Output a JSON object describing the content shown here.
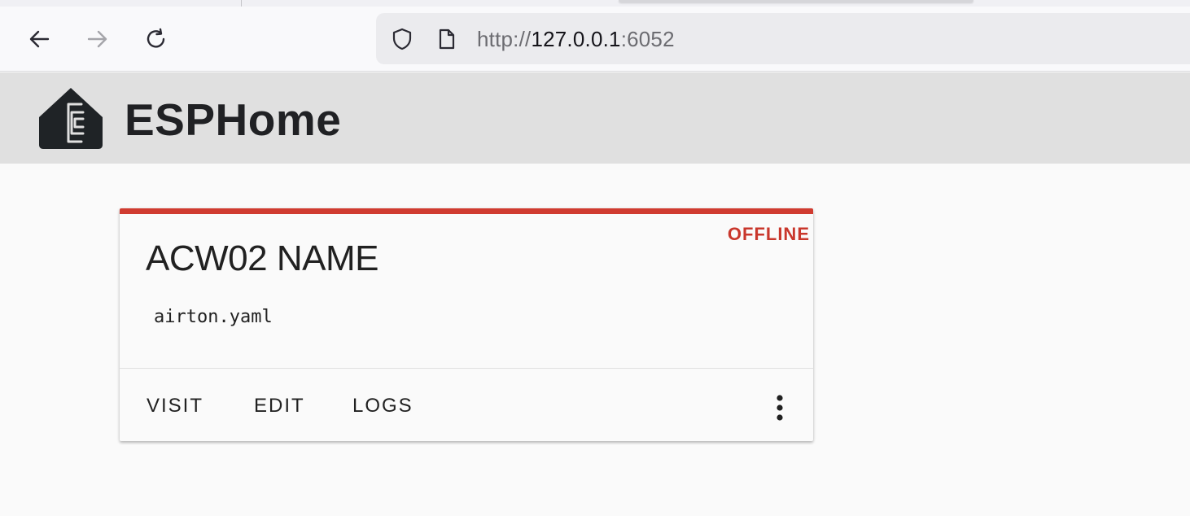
{
  "browser": {
    "url_scheme": "http://",
    "url_host": "127.0.0.1",
    "url_port": ":6052",
    "icons": [
      "back-arrow-icon",
      "forward-arrow-icon",
      "reload-icon",
      "shield-icon",
      "page-icon"
    ]
  },
  "app": {
    "title": "ESPHome",
    "logo_icon": "esphome-logo-icon",
    "header_color": "#e0e0e0"
  },
  "device_card": {
    "name": "ACW02 NAME",
    "status": "OFFLINE",
    "status_color": "#c9372c",
    "config_file": "airton.yaml",
    "actions": {
      "visit": "VISIT",
      "edit": "EDIT",
      "logs": "LOGS"
    },
    "menu_icon": "more-vertical-icon"
  }
}
